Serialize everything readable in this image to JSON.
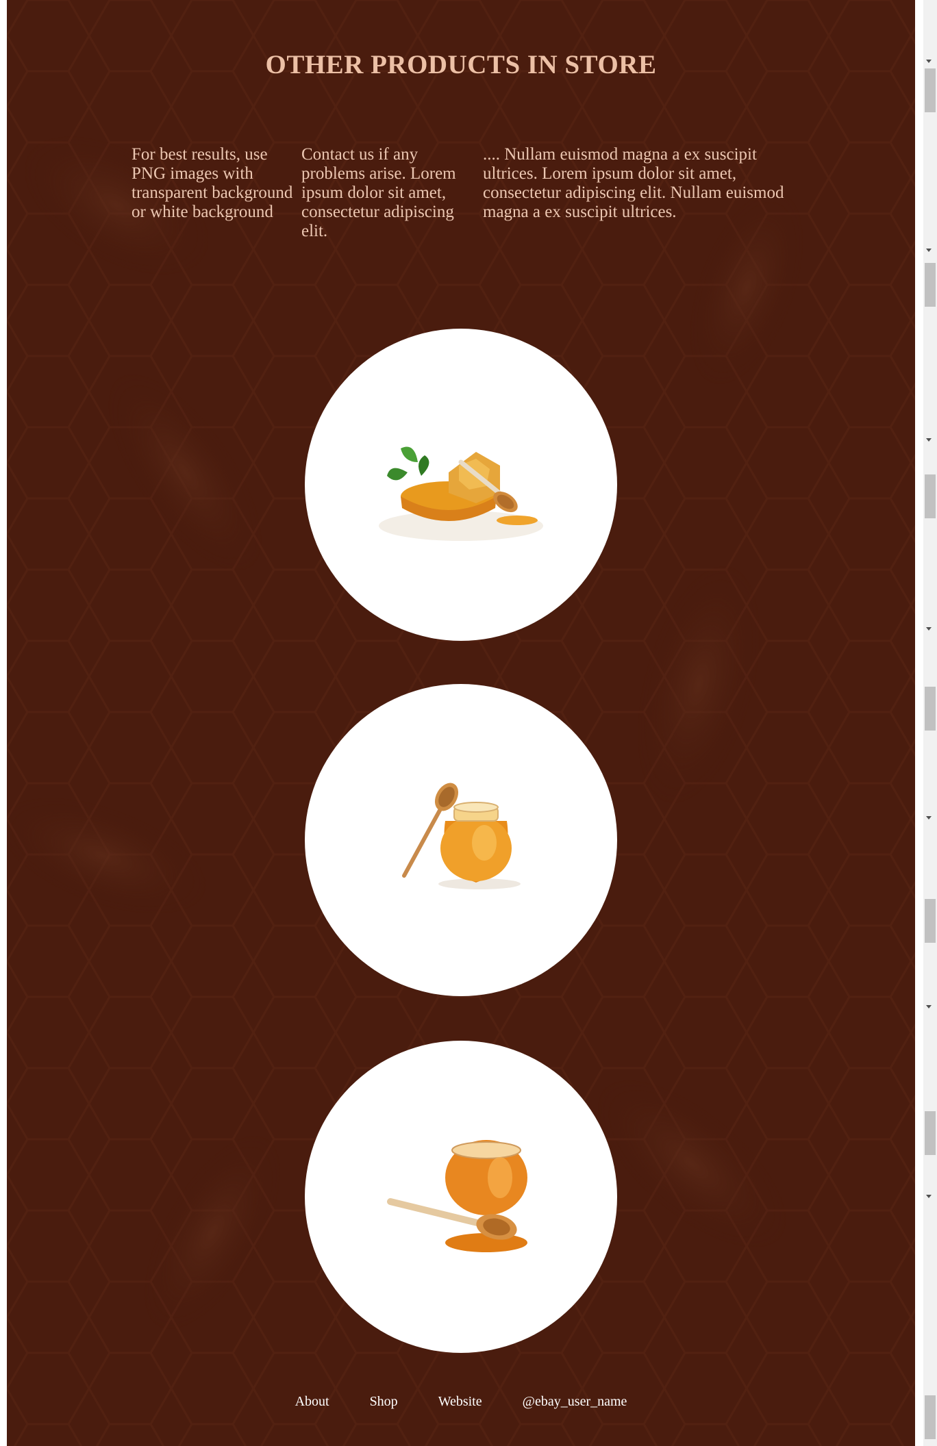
{
  "heading": "OTHER PRODUCTS IN STORE",
  "columns": [
    "For best results, use PNG images with transparent background or white background",
    "Contact us if any problems arise. Lorem ipsum dolor sit amet, consectetur adipiscing elit.",
    ".... Nullam euismod magna a ex suscipit ultrices. Lorem ipsum dolor sit amet, consectetur adipiscing elit. Nullam euismod magna a ex suscipit ultrices."
  ],
  "products": [
    {
      "image": "honeycomb-with-dipper-and-mint"
    },
    {
      "image": "honey-jar-with-wooden-dipper"
    },
    {
      "image": "honey-pot-with-dipper-in-puddle"
    }
  ],
  "footer": {
    "about": "About",
    "shop": "Shop",
    "website": "Website",
    "handle": "@ebay_user_name"
  },
  "colors": {
    "background": "#4a1c0e",
    "heading": "#ecc0a6",
    "body_text": "#ecc7b2",
    "footer_text": "#ffffff",
    "honey": "#e8951c"
  }
}
